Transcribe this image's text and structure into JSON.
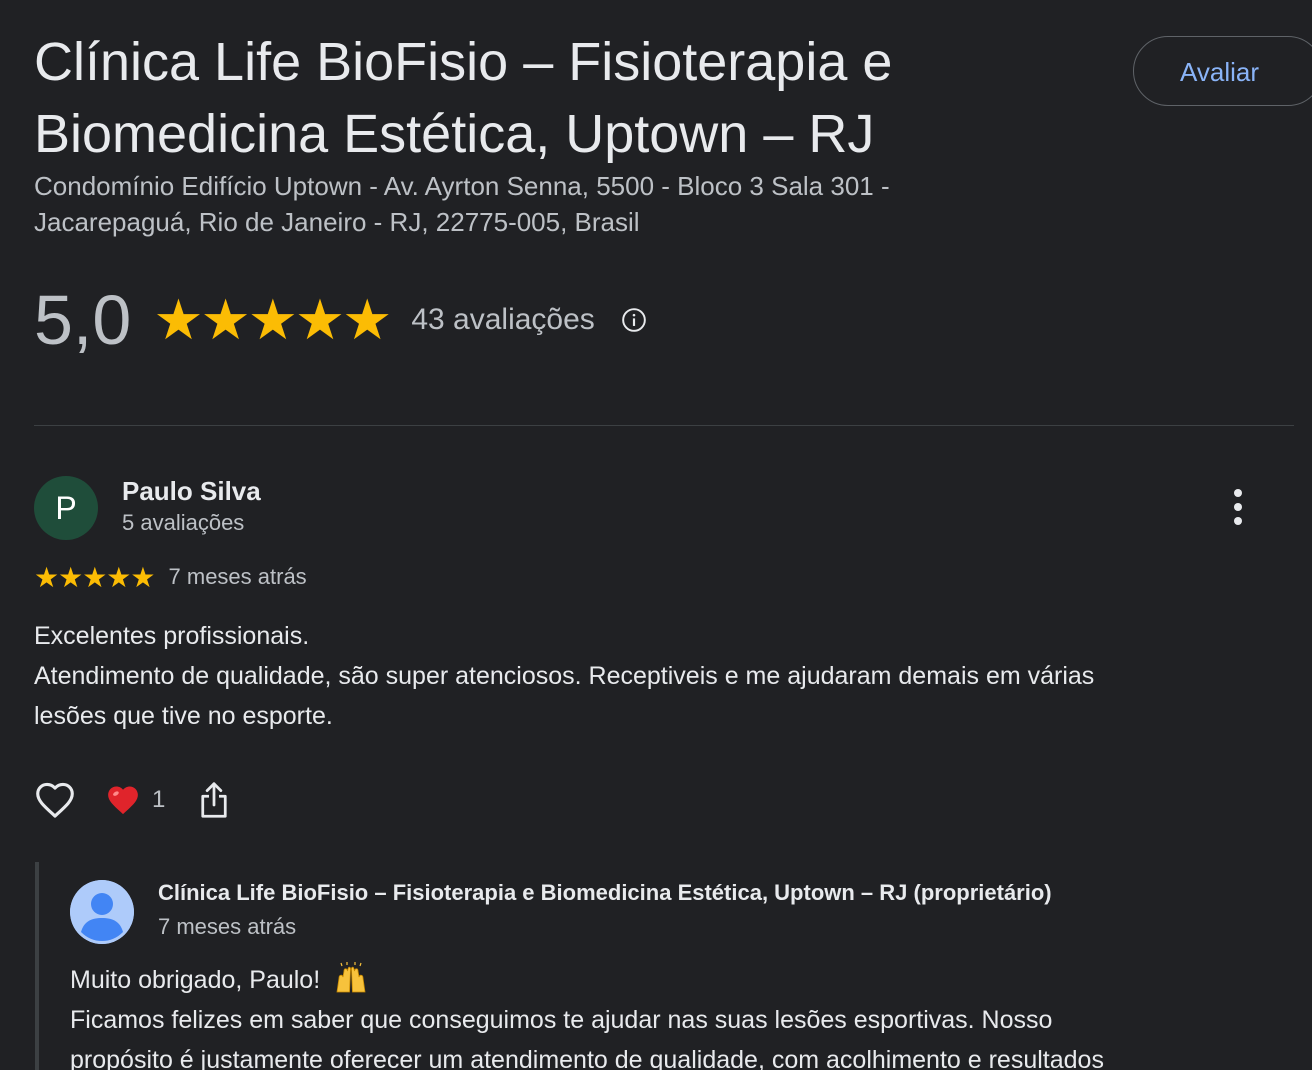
{
  "place": {
    "title_line1": "Clínica Life BioFisio – Fisioterapia e",
    "title_line2": "Biomedicina Estética, Uptown – RJ",
    "address_line1": "Condomínio Edifício Uptown - Av. Ayrton Senna, 5500 - Bloco 3 Sala 301 -",
    "address_line2": "Jacarepaguá, Rio de Janeiro - RJ, 22775-005, Brasil",
    "rate_button_label": "Avaliar"
  },
  "summary": {
    "score": "5,0",
    "stars": "★★★★★",
    "star_rating": 5,
    "count_label": "43 avaliações",
    "info_icon": "info-icon"
  },
  "review": {
    "avatar_letter": "P",
    "reviewer_name": "Paulo Silva",
    "reviewer_reviews": "5 avaliações",
    "stars": "★★★★★",
    "star_rating": 5,
    "time": "7 meses atrás",
    "text_lines": [
      "Excelentes profissionais.",
      "Atendimento de qualidade, são super atenciosos. Receptiveis e me ajudaram demais em várias",
      "lesões que tive no esporte."
    ],
    "reaction_count": "1",
    "icons": [
      "heart-outline-icon",
      "red-heart-emoji",
      "share-icon",
      "more-vert-icon"
    ]
  },
  "owner_reply": {
    "name": "Clínica Life BioFisio – Fisioterapia e Biomedicina Estética, Uptown – RJ (proprietário)",
    "time": "7 meses atrás",
    "line1": "Muito obrigado, Paulo!",
    "line1_emoji": "raising-hands-emoji",
    "line2": "Ficamos felizes em saber que conseguimos te ajudar nas suas lesões esportivas. Nosso",
    "line3": "propósito é justamente oferecer um atendimento de qualidade, com acolhimento e resultados"
  },
  "colors": {
    "background": "#202124",
    "star": "#fbbc04",
    "link": "#8ab4f8",
    "text_primary": "#e8eaed",
    "text_secondary": "#bdc1c6",
    "reviewer_avatar": "#1f4d3a",
    "owner_avatar": "#aecbfa"
  }
}
